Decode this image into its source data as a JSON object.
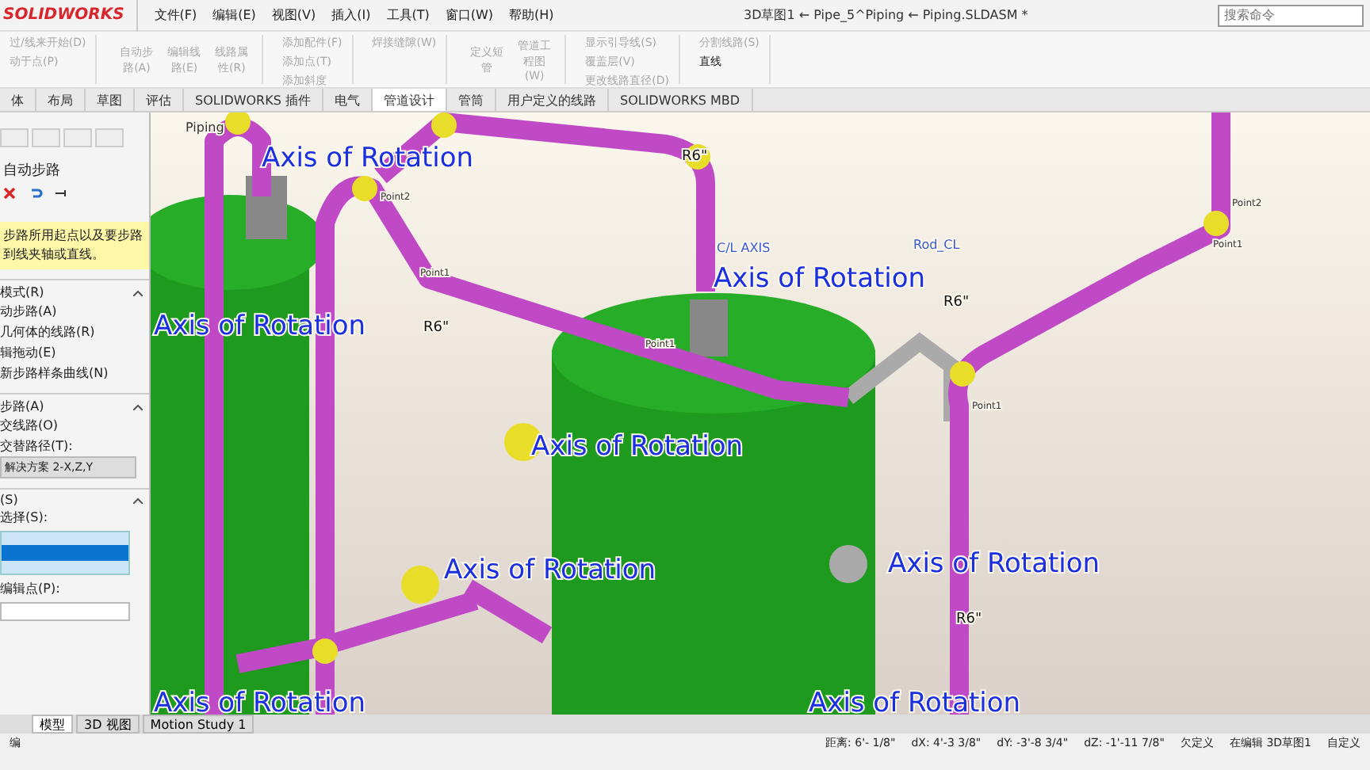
{
  "window": {
    "logo": "SOLIDWORKS",
    "menus": [
      "文件(F)",
      "编辑(E)",
      "视图(V)",
      "插入(I)",
      "工具(T)",
      "窗口(W)",
      "帮助(H)"
    ],
    "title": "3D草图1 ← Pipe_5^Piping ← Piping.SLDASM *",
    "search": {
      "placeholder": "搜索命令"
    }
  },
  "ribbon": {
    "groups": [
      {
        "kind": "list",
        "items": [
          "过/线来开始(D)",
          "动于点(P)"
        ]
      },
      {
        "kind": "big",
        "items": [
          "自动步路(A)",
          "编辑线路(E)",
          "线路属性(R)"
        ]
      },
      {
        "kind": "list",
        "items": [
          "添加配件(F)",
          "添加点(T)",
          "添加斜度"
        ]
      },
      {
        "kind": "list",
        "items": [
          "焊接缝隙(W)"
        ]
      },
      {
        "kind": "big",
        "items": [
          "定义短管",
          "管道工程图(W)"
        ]
      },
      {
        "kind": "list",
        "items": [
          "显示引导线(S)",
          "覆盖层(V)",
          "更改线路直径(D)"
        ]
      },
      {
        "kind": "active",
        "items": [
          "分割线路(S)",
          "直线"
        ]
      }
    ]
  },
  "tabs": [
    {
      "label": "体",
      "selected": false
    },
    {
      "label": "布局",
      "selected": false
    },
    {
      "label": "草图",
      "selected": false
    },
    {
      "label": "评估",
      "selected": false
    },
    {
      "label": "SOLIDWORKS 插件",
      "selected": false
    },
    {
      "label": "电气",
      "selected": false
    },
    {
      "label": "管道设计",
      "selected": true
    },
    {
      "label": "管筒",
      "selected": false
    },
    {
      "label": "用户定义的线路",
      "selected": false
    },
    {
      "label": "SOLIDWORKS MBD",
      "selected": false
    }
  ],
  "panel": {
    "title": "自动步路",
    "message": "步路所用起点以及要步路到线夹轴或直线。",
    "sections": [
      {
        "title": "模式(R)",
        "rows": [
          {
            "label": "动步路(A)",
            "kind": "option"
          },
          {
            "label": "几何体的线路(R)",
            "kind": "option"
          },
          {
            "label": "辑拖动(E)",
            "kind": "option"
          },
          {
            "label": "新步路样条曲线(N)",
            "kind": "option"
          }
        ]
      },
      {
        "title": "步路(A)",
        "rows": [
          {
            "label": "交线路(O)",
            "kind": "option"
          },
          {
            "label": "交替路径(T):",
            "kind": "option"
          },
          {
            "label": "解决方案 2-X,Z,Y",
            "kind": "combo"
          }
        ]
      },
      {
        "title": "(S)",
        "rows": [
          {
            "label": "选择(S):",
            "kind": "option"
          },
          {
            "label": "",
            "kind": "list"
          },
          {
            "label": "编辑点(P):",
            "kind": "option"
          },
          {
            "label": "",
            "kind": "field"
          }
        ]
      }
    ]
  },
  "viewport": {
    "tree_label": "Piping",
    "labels": [
      {
        "text": "Axis of Rotation",
        "kind": "axis"
      },
      {
        "text": "Axis of Rotation",
        "kind": "axis"
      },
      {
        "text": "Axis of Rotation",
        "kind": "axis"
      },
      {
        "text": "Axis of Rotation",
        "kind": "axis"
      },
      {
        "text": "Axis of Rotation",
        "kind": "axis"
      },
      {
        "text": "Axis of Rotation",
        "kind": "axis"
      },
      {
        "text": "Axis of Rotation",
        "kind": "axis"
      },
      {
        "text": "Axis of Rotation",
        "kind": "axis"
      },
      {
        "text": "R6\"",
        "kind": "radius"
      },
      {
        "text": "R6\"",
        "kind": "radius"
      },
      {
        "text": "R6\"",
        "kind": "radius"
      },
      {
        "text": "R6\"",
        "kind": "radius"
      },
      {
        "text": "C/L AXIS",
        "kind": "axisname"
      },
      {
        "text": "Rod_CL",
        "kind": "axisname"
      },
      {
        "text": "Point1",
        "kind": "point"
      },
      {
        "text": "Point2",
        "kind": "point"
      },
      {
        "text": "Point2",
        "kind": "point"
      },
      {
        "text": "Point1",
        "kind": "point"
      },
      {
        "text": "Point1",
        "kind": "point"
      },
      {
        "text": "Point1",
        "kind": "point"
      }
    ]
  },
  "bottom_tabs": [
    {
      "label": "模型",
      "selected": true
    },
    {
      "label": "3D 视图",
      "selected": false
    },
    {
      "label": "Motion Study 1",
      "selected": false
    }
  ],
  "status_bar": {
    "left": "编",
    "readings": [
      "距离: 6'- 1/8\"",
      "dX: 4'-3 3/8\"",
      "dY: -3'-8 3/4\"",
      "dZ: -1'-11 7/8\"",
      "欠定义",
      "在编辑 3D草图1",
      "自定义"
    ]
  }
}
